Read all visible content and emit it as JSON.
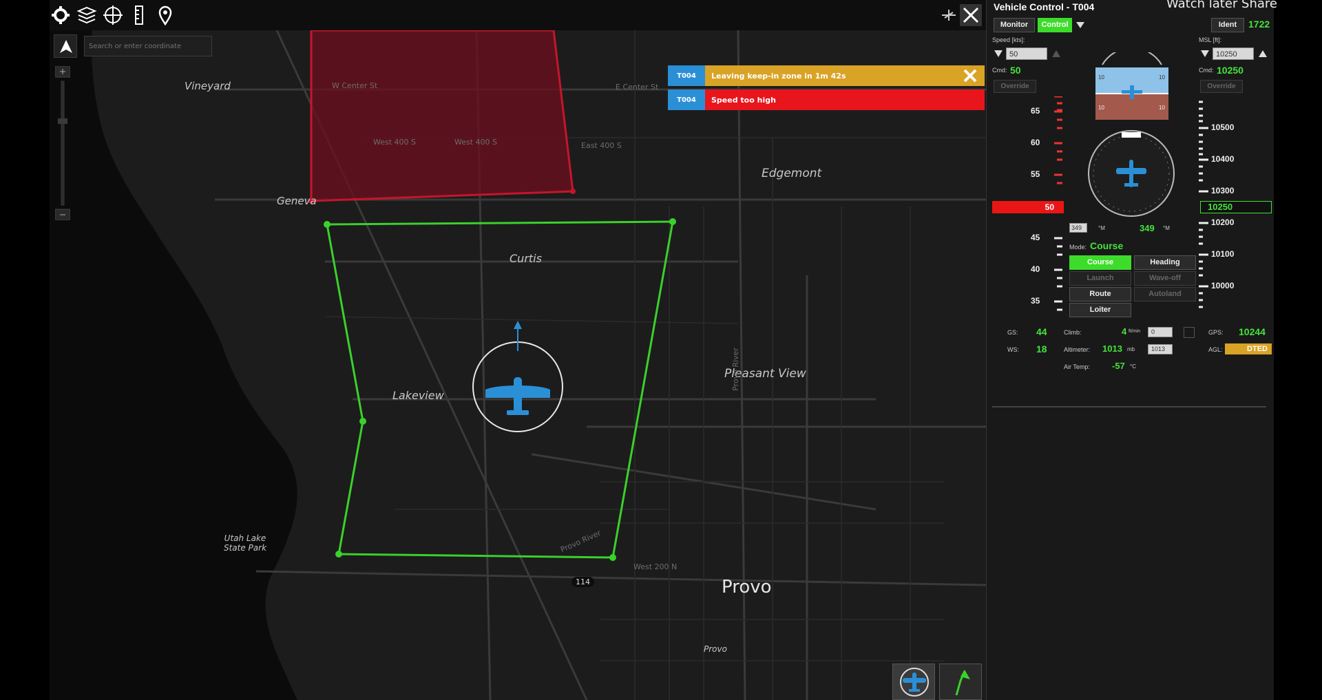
{
  "map": {
    "search_placeholder": "Search or enter coordinate",
    "alerts": [
      {
        "tag": "T004",
        "message": "Leaving keep-in zone in 1m 42s",
        "type": "warning"
      },
      {
        "tag": "T004",
        "message": "Speed too high",
        "type": "error"
      }
    ],
    "places": [
      "Vineyard",
      "Geneva",
      "Curtis",
      "Edgemont",
      "Lakeview",
      "Pleasant View",
      "Utah Lake State Park",
      "Provo",
      "Provo"
    ],
    "streets": [
      "W Center St",
      "West 400 S",
      "West 400 S",
      "E Center St",
      "East 400 S",
      "West 200 N",
      "114",
      "Provo River",
      "Provo River"
    ]
  },
  "panel": {
    "title": "Vehicle Control - T004",
    "overlay_text": "Watch later    Share",
    "buttons": {
      "monitor": "Monitor",
      "control": "Control",
      "ident": "Ident",
      "ident_code": "1722",
      "speed_override": "Override",
      "alt_override": "Override"
    },
    "speed": {
      "label": "Speed [kts]:",
      "input": "50",
      "cmd_label": "Cmd:",
      "cmd_value": "50",
      "current": "50",
      "ticks": [
        "65",
        "60",
        "55",
        "45",
        "40",
        "35"
      ]
    },
    "altitude": {
      "label": "MSL [ft]:",
      "input": "10250",
      "cmd_label": "Cmd:",
      "cmd_value": "10250",
      "current": "10250",
      "ticks": [
        "10500",
        "10400",
        "10300",
        "10200",
        "10100",
        "10000"
      ]
    },
    "attitude_ticks": [
      "10",
      "10",
      "10",
      "10"
    ],
    "heading": {
      "input": "349",
      "unit": "°M",
      "value": "349",
      "unit2": "°M"
    },
    "mode": {
      "label": "Mode:",
      "value": "Course",
      "buttons": [
        "Course",
        "Heading",
        "Launch",
        "Wave-off",
        "Route",
        "Autoland",
        "Loiter"
      ]
    },
    "readouts": {
      "gs_label": "GS:",
      "gs_value": "44",
      "ws_label": "WS:",
      "ws_value": "18",
      "climb_label": "Climb:",
      "climb_value": "4",
      "climb_unit": "ft/min",
      "climb_input": "0",
      "altimeter_label": "Altimeter:",
      "altimeter_value": "1013",
      "altimeter_unit": "mb",
      "altimeter_input": "1013",
      "airtemp_label": "Air Temp:",
      "airtemp_value": "-57",
      "airtemp_unit": "°C",
      "gps_label": "GPS:",
      "gps_value": "10244",
      "agl_label": "AGL:",
      "agl_value": "DTED"
    }
  },
  "colors": {
    "keepin": "#3ad12a",
    "keepout": "#b0122a",
    "accent_green": "#44e33a",
    "aircraft_blue": "#2b8fd6",
    "warn": "#d9a326",
    "error": "#e8151c"
  }
}
